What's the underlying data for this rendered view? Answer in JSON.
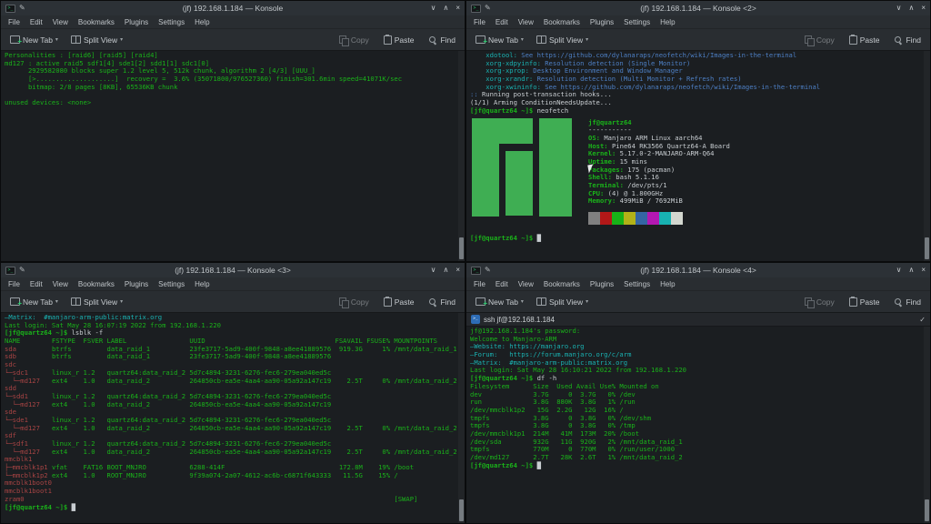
{
  "icons": {
    "chevron_down": "▾",
    "minimize": "∨",
    "maximize": "∧",
    "close": "×",
    "checkmark": "✓"
  },
  "colors": {
    "terminal_green": "#1ab21a",
    "terminal_cyan": "#1ab2b2",
    "link_blue": "#4d7fc4",
    "manjaro_logo_green": "#3fae53",
    "terminal_background": "#1b1e21"
  },
  "chrome": {
    "menu": [
      "File",
      "Edit",
      "View",
      "Bookmarks",
      "Plugins",
      "Settings",
      "Help"
    ],
    "toolbar": {
      "new_tab": "New Tab",
      "split_view": "Split View",
      "copy": "Copy",
      "paste": "Paste",
      "find": "Find"
    }
  },
  "windows": [
    {
      "title": "(jf) 192.168.1.184 — Konsole",
      "lines": [
        "Personalities : [raid6] [raid5] [raid4]",
        "md127 : active raid5 sdf1[4] sde1[2] sdd1[1] sdc1[0]",
        "      2929582080 blocks super 1.2 level 5, 512k chunk, algorithm 2 [4/3] [UUU_]",
        "      [>....................]  recovery =  3.6% (35071800/976527360) finish=301.6min speed=41071K/sec",
        "      bitmap: 2/8 pages [8KB], 65536KB chunk",
        "",
        "unused devices: <none>"
      ]
    },
    {
      "title": "(jf) 192.168.1.184 — Konsole <2>",
      "lines_before": [
        [
          {
            "t": "    xdotool: ",
            "c": "c"
          },
          {
            "t": "See https://github.com/dylanaraps/neofetch/wiki/Images-in-the-terminal",
            "c": "b"
          }
        ],
        [
          {
            "t": "    xorg-xdpyinfo: ",
            "c": "c"
          },
          {
            "t": "Resolution detection (Single Monitor)",
            "c": "b"
          }
        ],
        [
          {
            "t": "    xorg-xprop: ",
            "c": "c"
          },
          {
            "t": "Desktop Environment and Window Manager",
            "c": "b"
          }
        ],
        [
          {
            "t": "    xorg-xrandr: ",
            "c": "c"
          },
          {
            "t": "Resolution detection (Multi Monitor + Refresh rates)",
            "c": "b"
          }
        ],
        [
          {
            "t": "    xorg-xwininfo: ",
            "c": "c"
          },
          {
            "t": "See https://github.com/dylanaraps/neofetch/wiki/Images-in-the-terminal",
            "c": "b"
          }
        ],
        [
          {
            "t": ":: ",
            "c": "b"
          },
          {
            "t": "Running post-transaction hooks...",
            "c": "w"
          }
        ],
        [
          {
            "t": "(1/1) Arming ConditionNeedsUpdate...",
            "c": "w"
          }
        ],
        [
          {
            "t": "[jf@quartz64 ~]$ ",
            "c": "p"
          },
          {
            "t": "neofetch",
            "c": "w"
          }
        ]
      ],
      "neofetch": {
        "title": "jf@quartz64",
        "separator": "-----------",
        "info": [
          {
            "label": "OS",
            "value": "Manjaro ARM Linux aarch64"
          },
          {
            "label": "Host",
            "value": "Pine64 RK3566 Quartz64-A Board"
          },
          {
            "label": "Kernel",
            "value": "5.17.0-2-MANJARO-ARM-Q64"
          },
          {
            "label": "Uptime",
            "value": "15 mins"
          },
          {
            "label": "Packages",
            "value": "175 (pacman)"
          },
          {
            "label": "Shell",
            "value": "bash 5.1.16"
          },
          {
            "label": "Terminal",
            "value": "/dev/pts/1"
          },
          {
            "label": "CPU",
            "value": "(4) @ 1.800GHz"
          },
          {
            "label": "Memory",
            "value": "499MiB / 7692MiB"
          }
        ],
        "palette": [
          "#808080",
          "#b21818",
          "#18b218",
          "#b2b218",
          "#3465a4",
          "#b218b2",
          "#18b2b2",
          "#d3d7cf"
        ]
      },
      "lines_after": [
        "",
        [
          {
            "t": "[jf@quartz64 ~]$ ",
            "c": "p"
          },
          {
            "t": "█",
            "c": "w"
          }
        ]
      ]
    },
    {
      "title": "(jf) 192.168.1.184 — Konsole <3>",
      "lines": [
        [
          {
            "t": "—Matrix:  #manjaro-arm-public:matrix.org",
            "c": "c"
          }
        ],
        "Last login: Sat May 28 16:07:19 2022 from 192.168.1.220",
        [
          {
            "t": "[jf@quartz64 ~]$ ",
            "c": "p"
          },
          {
            "t": "lsblk -f",
            "c": "w"
          }
        ],
        "NAME        FSTYPE  FSVER LABEL                UUID                                 FSAVAIL FSUSE% MOUNTPOINTS",
        [
          {
            "t": "sda         ",
            "c": "r"
          },
          {
            "t": "btrfs         data_raid_1          23fe3717-5ad9-400f-9848-a8ee41889576  919.3G     1% /mnt/data_raid_1",
            "c": "g"
          }
        ],
        [
          {
            "t": "sdb         ",
            "c": "r"
          },
          {
            "t": "btrfs         data_raid_1          23fe3717-5ad9-400f-9848-a8ee41889576",
            "c": "g"
          }
        ],
        [
          {
            "t": "sdc",
            "c": "r"
          }
        ],
        [
          {
            "t": "└─sdc1      ",
            "c": "r"
          },
          {
            "t": "linux_r 1.2   quartz64:data_raid_2 5d7c4894-3231-6276-fec6-279ea040ed5c",
            "c": "g"
          }
        ],
        [
          {
            "t": "  └─md127   ",
            "c": "r"
          },
          {
            "t": "ext4    1.0   data_raid_2          264850cb-ea5e-4aa4-aa90-05a92a147c19    2.5T     0% /mnt/data_raid_2",
            "c": "g"
          }
        ],
        [
          {
            "t": "sdd",
            "c": "r"
          }
        ],
        [
          {
            "t": "└─sdd1      ",
            "c": "r"
          },
          {
            "t": "linux_r 1.2   quartz64:data_raid_2 5d7c4894-3231-6276-fec6-279ea040ed5c",
            "c": "g"
          }
        ],
        [
          {
            "t": "  └─md127   ",
            "c": "r"
          },
          {
            "t": "ext4    1.0   data_raid_2          264850cb-ea5e-4aa4-aa90-05a92a147c19",
            "c": "g"
          }
        ],
        [
          {
            "t": "sde",
            "c": "r"
          }
        ],
        [
          {
            "t": "└─sde1      ",
            "c": "r"
          },
          {
            "t": "linux_r 1.2   quartz64:data_raid_2 5d7c4894-3231-6276-fec6-279ea040ed5c",
            "c": "g"
          }
        ],
        [
          {
            "t": "  └─md127   ",
            "c": "r"
          },
          {
            "t": "ext4    1.0   data_raid_2          264850cb-ea5e-4aa4-aa90-05a92a147c19    2.5T     0% /mnt/data_raid_2",
            "c": "g"
          }
        ],
        [
          {
            "t": "sdf",
            "c": "r"
          }
        ],
        [
          {
            "t": "└─sdf1      ",
            "c": "r"
          },
          {
            "t": "linux_r 1.2   quartz64:data_raid_2 5d7c4894-3231-6276-fec6-279ea040ed5c",
            "c": "g"
          }
        ],
        [
          {
            "t": "  └─md127   ",
            "c": "r"
          },
          {
            "t": "ext4    1.0   data_raid_2          264850cb-ea5e-4aa4-aa90-05a92a147c19    2.5T     0% /mnt/data_raid_2",
            "c": "g"
          }
        ],
        [
          {
            "t": "mmcblk1",
            "c": "r"
          }
        ],
        [
          {
            "t": "├─mmcblk1p1 ",
            "c": "r"
          },
          {
            "t": "vfat    FAT16 BOOT_MNJRO           6288-414F                             172.8M    19% /boot",
            "c": "g"
          }
        ],
        [
          {
            "t": "└─mmcblk1p2 ",
            "c": "r"
          },
          {
            "t": "ext4    1.0   ROOT_MNJRO           9f39a074-2a07-4612-ac6b-c6871f643333   11.5G    15% /",
            "c": "g"
          }
        ],
        [
          {
            "t": "mmcblk1boot0",
            "c": "r"
          }
        ],
        [
          {
            "t": "mmcblk1boot1",
            "c": "r"
          }
        ],
        [
          {
            "t": "zram0",
            "c": "r"
          },
          {
            "t": "                                                                                              [SWAP]",
            "c": "g"
          }
        ],
        [
          {
            "t": "[jf@quartz64 ~]$ ",
            "c": "p"
          },
          {
            "t": "█",
            "c": "w"
          }
        ]
      ]
    },
    {
      "title": "(jf) 192.168.1.184 — Konsole <4>",
      "tab": {
        "label": "ssh jf@192.168.1.184"
      },
      "lines": [
        "jf@192.168.1.184's password:",
        "Welcome to Manjaro-ARM",
        [
          {
            "t": "—Website: https://manjaro.org",
            "c": "c"
          }
        ],
        [
          {
            "t": "—Forum:   https://forum.manjaro.org/c/arm",
            "c": "c"
          }
        ],
        [
          {
            "t": "—Matrix:  #manjaro-arm-public:matrix.org",
            "c": "c"
          }
        ],
        "Last login: Sat May 28 16:10:21 2022 from 192.168.1.220",
        [
          {
            "t": "[jf@quartz64 ~]$ ",
            "c": "p"
          },
          {
            "t": "df -h",
            "c": "w"
          }
        ],
        "Filesystem      Size  Used Avail Use% Mounted on",
        "dev             3.7G     0  3.7G   0% /dev",
        "run             3.8G  880K  3.8G   1% /run",
        "/dev/mmcblk1p2   15G  2.2G   12G  16% /",
        "tmpfs           3.8G     0  3.8G   0% /dev/shm",
        "tmpfs           3.8G     0  3.8G   0% /tmp",
        "/dev/mmcblk1p1  214M   41M  173M  20% /boot",
        "/dev/sda        932G   11G  920G   2% /mnt/data_raid_1",
        "tmpfs           770M     0  770M   0% /run/user/1000",
        "/dev/md127      2.7T   28K  2.6T   1% /mnt/data_raid_2",
        [
          {
            "t": "[jf@quartz64 ~]$ ",
            "c": "p"
          },
          {
            "t": "█",
            "c": "w"
          }
        ]
      ]
    }
  ]
}
